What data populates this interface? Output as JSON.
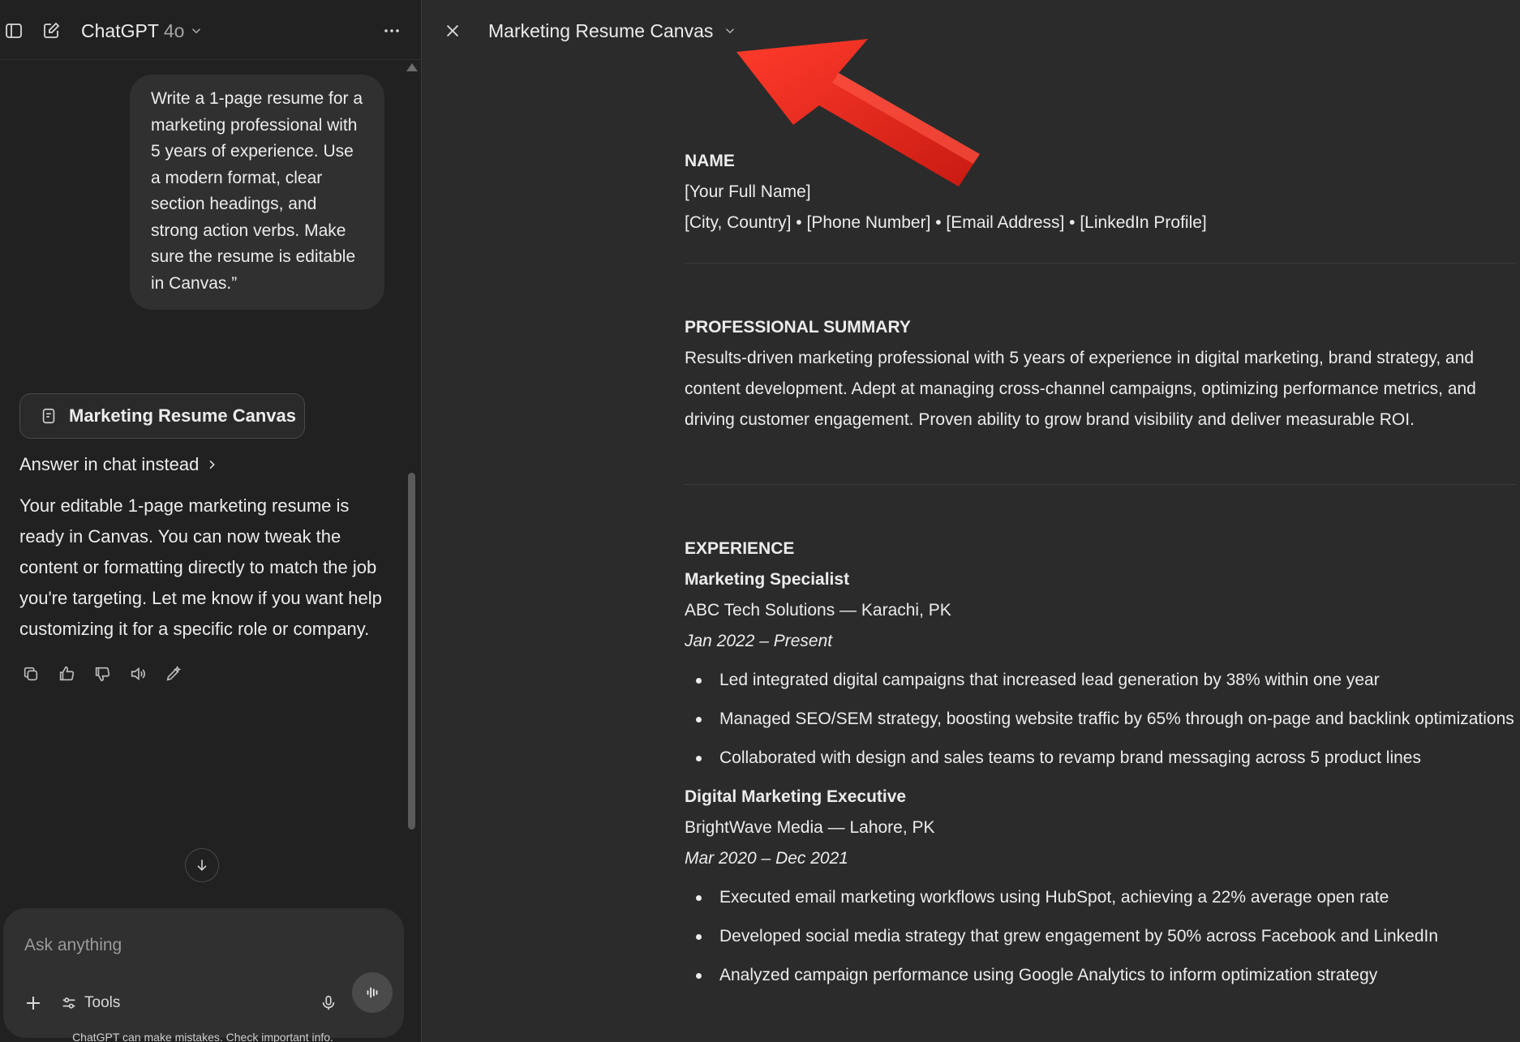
{
  "header": {
    "model_name": "ChatGPT",
    "model_version": "4o"
  },
  "conversation": {
    "user_message": "Write a 1-page resume for a marketing professional with 5 years of experience. Use a modern format, clear section headings, and strong action verbs. Make sure the resume is editable in Canvas.”",
    "canvas_chip_label": "Marketing Resume Canvas",
    "answer_in_chat_label": "Answer in chat instead",
    "assistant_message": "Your editable 1-page marketing resume is ready in Canvas. You can now tweak the content or formatting directly to match the job you're targeting. Let me know if you want help customizing it for a specific role or company.",
    "actions": [
      "copy-icon",
      "thumbs-up-icon",
      "thumbs-down-icon",
      "read-aloud-icon",
      "edit-icon"
    ]
  },
  "composer": {
    "placeholder": "Ask anything",
    "tools_label": "Tools",
    "disclaimer": "ChatGPT can make mistakes. Check important info."
  },
  "canvas": {
    "title": "Marketing Resume Canvas",
    "annotation_color": "#e3261b",
    "name_heading": "NAME",
    "full_name": "[Your Full Name]",
    "contact": "[City, Country] • [Phone Number] • [Email Address] • [LinkedIn Profile]",
    "summary_heading": "PROFESSIONAL SUMMARY",
    "summary_text": "Results-driven marketing professional with 5 years of experience in digital marketing, brand strategy, and content development. Adept at managing cross-channel campaigns, optimizing performance metrics, and driving customer engagement. Proven ability to grow brand visibility and deliver measurable ROI.",
    "experience_heading": "EXPERIENCE",
    "jobs": [
      {
        "title": "Marketing Specialist",
        "company": "ABC Tech Solutions — Karachi, PK",
        "dates": "Jan 2022 – Present",
        "bullets": [
          "Led integrated digital campaigns that increased lead generation by 38% within one year",
          "Managed SEO/SEM strategy, boosting website traffic by 65% through on-page and backlink optimizations",
          "Collaborated with design and sales teams to revamp brand messaging across 5 product lines"
        ]
      },
      {
        "title": "Digital Marketing Executive",
        "company": "BrightWave Media — Lahore, PK",
        "dates": "Mar 2020 – Dec 2021",
        "bullets": [
          "Executed email marketing workflows using HubSpot, achieving a 22% average open rate",
          "Developed social media strategy that grew engagement by 50% across Facebook and LinkedIn",
          "Analyzed campaign performance using Google Analytics to inform optimization strategy"
        ]
      }
    ]
  }
}
